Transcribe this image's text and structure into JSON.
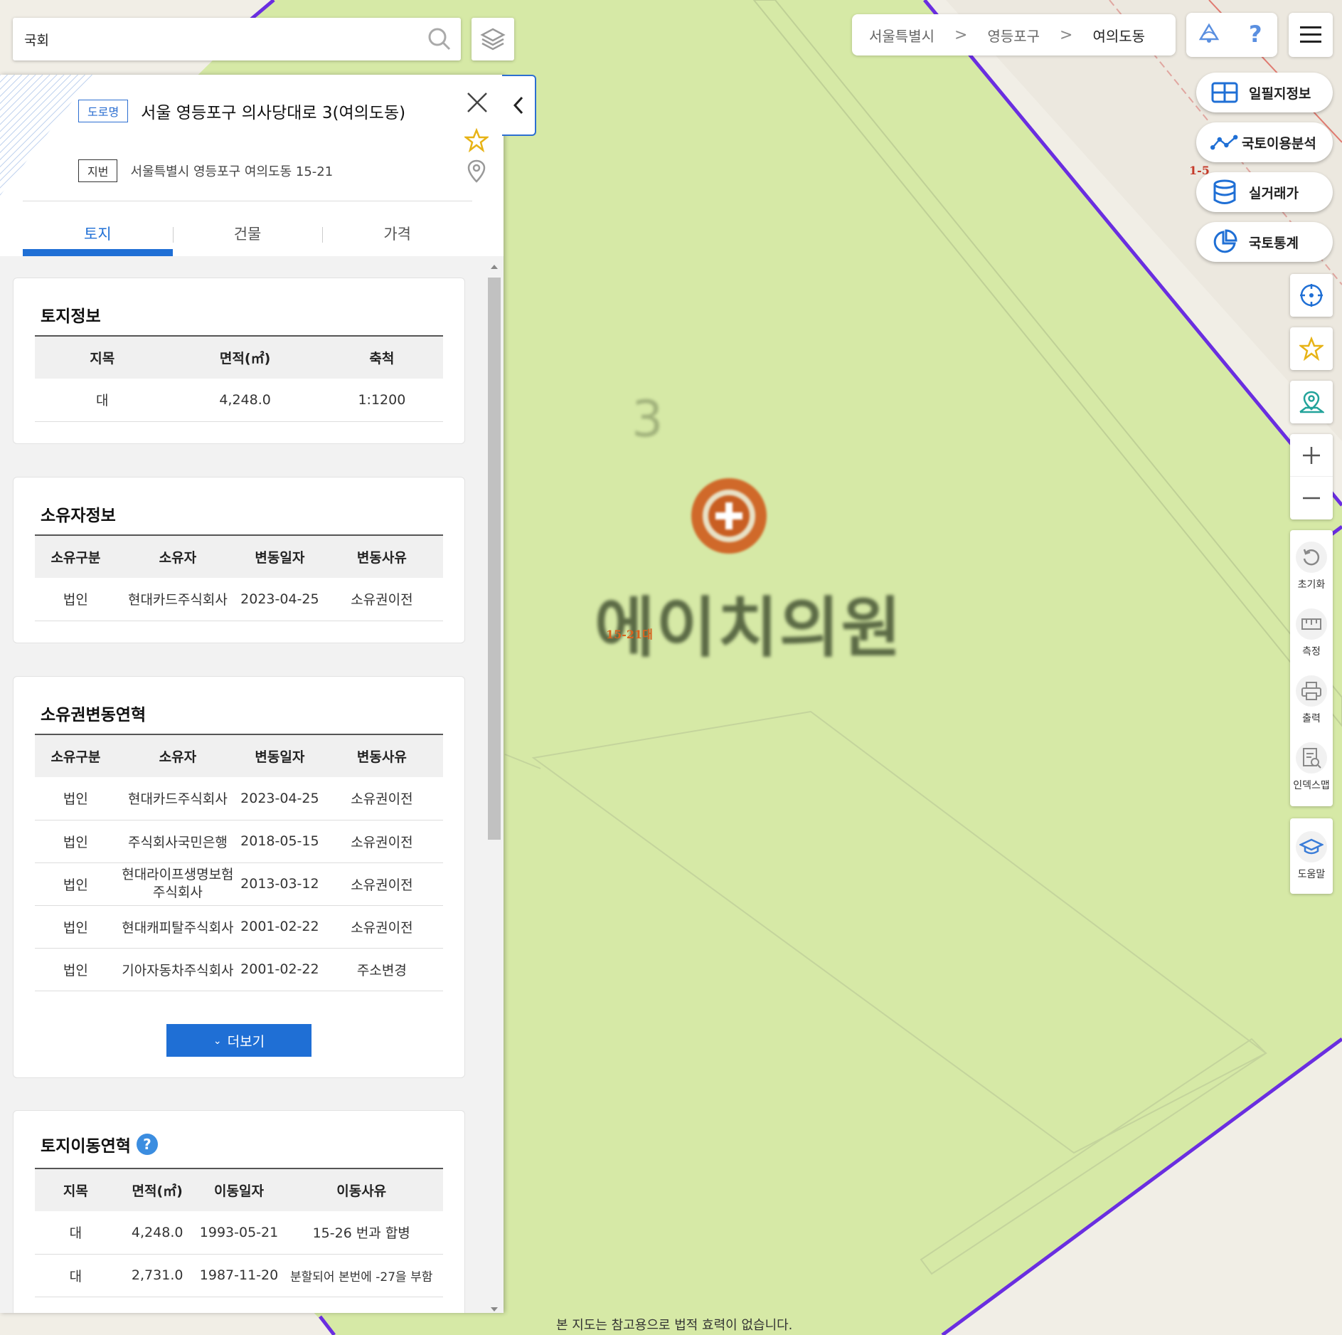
{
  "search": {
    "value": "국회",
    "placeholder": ""
  },
  "breadcrumb": [
    "서울특별시",
    "영등포구",
    "여의도동"
  ],
  "map": {
    "block_number": "3",
    "poi_name": "에이치의원",
    "parcel_label": "15-21대",
    "parcel_label_2": "1-5",
    "disclaimer": "본 지도는 참고용으로 법적 효력이 없습니다."
  },
  "right_menu": [
    {
      "label": "일필지정보",
      "icon": "grid-map-icon"
    },
    {
      "label": "국토이용분석",
      "icon": "analysis-line-icon"
    },
    {
      "label": "실거래가",
      "icon": "database-icon"
    },
    {
      "label": "국토통계",
      "icon": "pie-chart-icon"
    }
  ],
  "tools": {
    "reset": "초기화",
    "measure": "측정",
    "print": "출력",
    "indexmap": "인덱스맵",
    "help": "도움말"
  },
  "panel": {
    "road_tag": "도로명",
    "road_address": "서울 영등포구 의사당대로 3(여의도동)",
    "lot_tag": "지번",
    "lot_address": "서울특별시 영등포구 여의도동 15-21",
    "tabs": [
      "토지",
      "건물",
      "가격"
    ],
    "active_tab": 0,
    "land_info": {
      "title": "토지정보",
      "headers": [
        "지목",
        "면적(㎡)",
        "축척"
      ],
      "rows": [
        [
          "대",
          "4,248.0",
          "1:1200"
        ]
      ]
    },
    "owner_info": {
      "title": "소유자정보",
      "headers": [
        "소유구분",
        "소유자",
        "변동일자",
        "변동사유"
      ],
      "rows": [
        [
          "법인",
          "현대카드주식회사",
          "2023-04-25",
          "소유권이전"
        ]
      ]
    },
    "ownership_history": {
      "title": "소유권변동연혁",
      "headers": [
        "소유구분",
        "소유자",
        "변동일자",
        "변동사유"
      ],
      "rows": [
        [
          "법인",
          "현대카드주식회사",
          "2023-04-25",
          "소유권이전"
        ],
        [
          "법인",
          "주식회사국민은행",
          "2018-05-15",
          "소유권이전"
        ],
        [
          "법인",
          "현대라이프생명보험 주식회사",
          "2013-03-12",
          "소유권이전"
        ],
        [
          "법인",
          "현대캐피탈주식회사",
          "2001-02-22",
          "소유권이전"
        ],
        [
          "법인",
          "기아자동차주식회사",
          "2001-02-22",
          "주소변경"
        ]
      ],
      "more_label": "더보기"
    },
    "land_movement": {
      "title": "토지이동연혁",
      "help": "?",
      "headers": [
        "지목",
        "면적(㎡)",
        "이동일자",
        "이동사유"
      ],
      "rows": [
        [
          "대",
          "4,248.0",
          "1993-05-21",
          "15-26 번과 합병"
        ],
        [
          "대",
          "2,731.0",
          "1987-11-20",
          "분할되어 본번에 -27을 부함"
        ]
      ]
    }
  },
  "colors": {
    "accent": "#1f6fd5",
    "parcel_fill": "#d6e9a6",
    "boundary": "#6a2ee0"
  }
}
